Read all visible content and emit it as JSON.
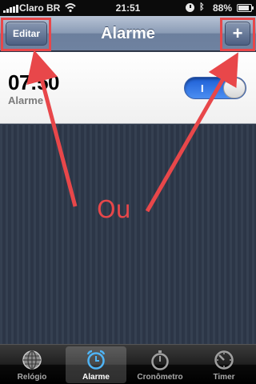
{
  "status_bar": {
    "carrier": "Claro BR",
    "time": "21:51",
    "battery": "88%",
    "battery_level": 0.88,
    "icons": [
      "signal-icon",
      "wifi-icon",
      "alarm-icon",
      "bluetooth-icon",
      "battery-icon"
    ]
  },
  "nav": {
    "edit_label": "Editar",
    "title": "Alarme",
    "add_label": "+"
  },
  "alarm": {
    "time": "07:50",
    "label": "Alarme",
    "toggle_label": "I",
    "enabled": true
  },
  "annotation": {
    "text": "Ou",
    "color": "#e8474a"
  },
  "tabs": [
    {
      "label": "Relógio",
      "icon": "globe-icon",
      "selected": false
    },
    {
      "label": "Alarme",
      "icon": "alarm-clock-icon",
      "selected": true
    },
    {
      "label": "Cronômetro",
      "icon": "stopwatch-icon",
      "selected": false
    },
    {
      "label": "Timer",
      "icon": "timer-icon",
      "selected": false
    }
  ]
}
